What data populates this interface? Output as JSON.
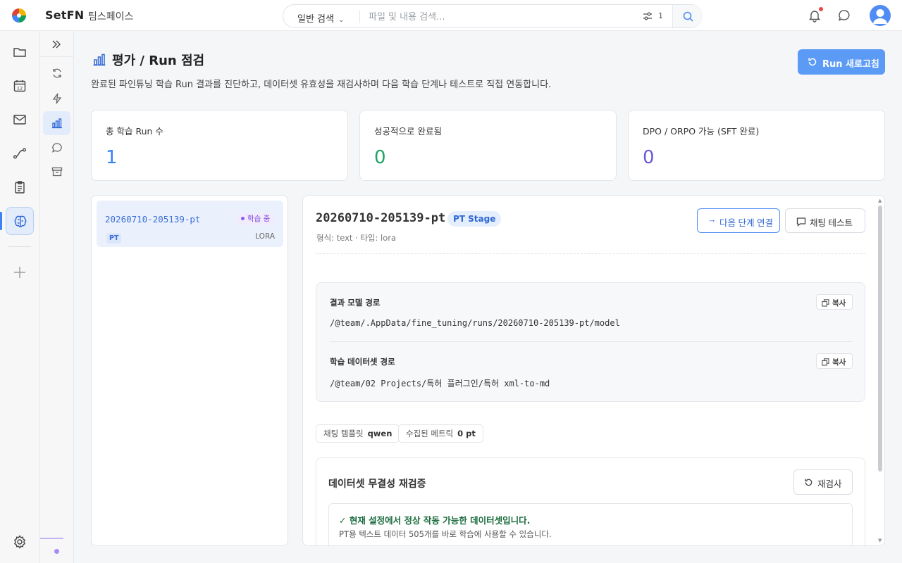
{
  "app": {
    "brand": "SetFN",
    "workspace": "팀스페이스"
  },
  "search": {
    "mode": "일반 검색",
    "placeholder": "파일 및 내용 검색...",
    "filter_count": "1"
  },
  "colors": {
    "accent": "#3b82f6",
    "primary_button": "#5b9af5",
    "success": "#1fa463",
    "purple": "#6a5ad6"
  },
  "rail": {
    "icons": [
      "folder-icon",
      "calendar-icon",
      "mail-icon",
      "flow-icon",
      "clipboard-icon",
      "brain-icon",
      "plus-icon",
      "settings-icon"
    ],
    "calendar_day": "12"
  },
  "subrail": {
    "icons": [
      "expand-icon",
      "sync-icon",
      "lightning-icon",
      "chart-icon",
      "chat-icon",
      "archive-icon"
    ]
  },
  "page": {
    "title": "평가 / Run 점검",
    "description": "완료된 파인튜닝 학습 Run 결과를 진단하고, 데이터셋 유효성을 재검사하며 다음 학습 단계나 테스트로 직접 연동합니다.",
    "refresh_label": "Run 새로고침"
  },
  "stats": [
    {
      "label": "총 학습 Run 수",
      "value": "1"
    },
    {
      "label": "성공적으로 완료됨",
      "value": "0"
    },
    {
      "label": "DPO / ORPO 가능 (SFT 완료)",
      "value": "0"
    }
  ],
  "runs": [
    {
      "name": "20260710-205139-pt",
      "status": "학습 중",
      "stage_tag": "PT",
      "type": "LORA"
    }
  ],
  "detail": {
    "title": "20260710-205139-pt",
    "badge": "PT Stage",
    "meta": "형식: text · 타입: lora",
    "next_label": "다음 단계 연결",
    "chat_label": "채팅 테스트",
    "model_path_label": "결과 모델 경로",
    "model_path": "/@team/.AppData/fine_tuning/runs/20260710-205139-pt/model",
    "dataset_path_label": "학습 데이터셋 경로",
    "dataset_path": "/@team/02 Projects/특허 플러그인/특허 xml-to-md",
    "copy_label": "복사",
    "chips": [
      {
        "label": "채팅 템플릿",
        "value": "qwen"
      },
      {
        "label": "수집된 메트릭",
        "value": "0 pt"
      }
    ],
    "integrity": {
      "title": "데이터셋 무결성 재검증",
      "recheck_label": "재검사",
      "ok_title": "✓ 현재 설정에서 정상 작동 가능한 데이터셋입니다.",
      "ok_desc": "PT용 텍스트 데이터 505개를 바로 학습에 사용할 수 있습니다."
    }
  }
}
